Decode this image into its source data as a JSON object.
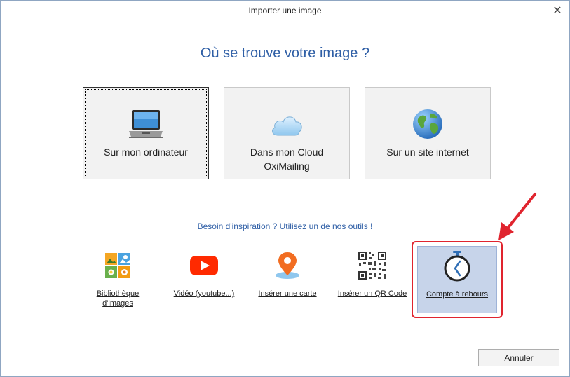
{
  "window": {
    "title": "Importer une image"
  },
  "heading": "Où se trouve votre image ?",
  "sources": [
    {
      "label": "Sur mon ordinateur",
      "icon": "laptop-icon"
    },
    {
      "label": "Dans mon Cloud OxiMailing",
      "icon": "cloud-icon"
    },
    {
      "label": "Sur un site internet",
      "icon": "globe-icon"
    }
  ],
  "inspiration": "Besoin d'inspiration ? Utilisez un de nos outils !",
  "tools": [
    {
      "label": "Bibliothèque d'images",
      "icon": "image-library-icon"
    },
    {
      "label": "Vidéo (youtube...)",
      "icon": "youtube-icon"
    },
    {
      "label": "Insérer une carte",
      "icon": "map-pin-icon"
    },
    {
      "label": "Insérer un QR Code",
      "icon": "qr-code-icon"
    },
    {
      "label": "Compte à rebours",
      "icon": "stopwatch-icon"
    }
  ],
  "buttons": {
    "cancel": "Annuler"
  },
  "colors": {
    "accent": "#2f5fa6",
    "highlight": "#e0242e",
    "selected": "#c7d4ea"
  }
}
